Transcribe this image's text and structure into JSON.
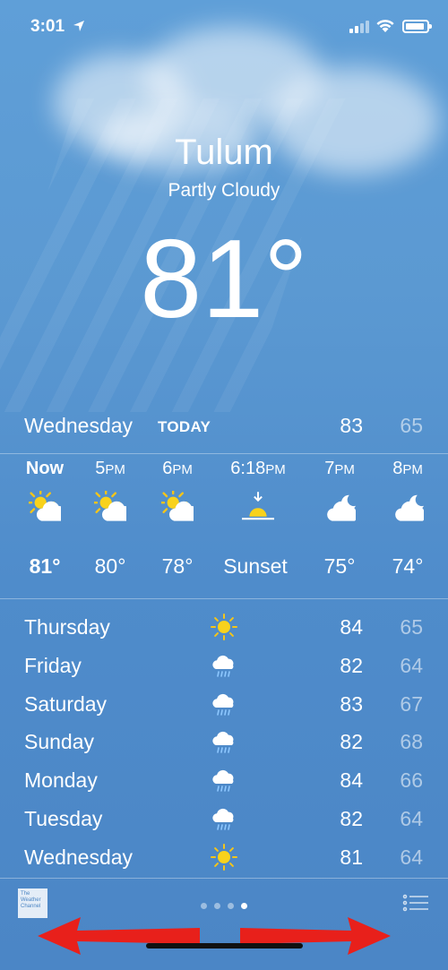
{
  "status_bar": {
    "time": "3:01",
    "location_icon": "location-arrow-icon",
    "signal_icon": "cellular-signal-icon",
    "wifi_icon": "wifi-icon",
    "battery_icon": "battery-icon"
  },
  "location": {
    "city": "Tulum",
    "condition": "Partly Cloudy",
    "temperature": "81°"
  },
  "today": {
    "day": "Wednesday",
    "tag": "TODAY",
    "high": "83",
    "low": "65"
  },
  "hourly": [
    {
      "time": "Now",
      "suffix": "",
      "icon": "partly-cloudy-day-icon",
      "temp": "81°"
    },
    {
      "time": "5",
      "suffix": "PM",
      "icon": "partly-cloudy-day-icon",
      "temp": "80°"
    },
    {
      "time": "6",
      "suffix": "PM",
      "icon": "partly-cloudy-day-icon",
      "temp": "78°"
    },
    {
      "time": "6:18",
      "suffix": "PM",
      "icon": "sunset-icon",
      "temp": "Sunset"
    },
    {
      "time": "7",
      "suffix": "PM",
      "icon": "partly-cloudy-night-icon",
      "temp": "75°"
    },
    {
      "time": "8",
      "suffix": "PM",
      "icon": "partly-cloudy-night-icon",
      "temp": "74°"
    }
  ],
  "daily": [
    {
      "day": "Thursday",
      "icon": "sun-icon",
      "high": "84",
      "low": "65"
    },
    {
      "day": "Friday",
      "icon": "rain-cloud-icon",
      "high": "82",
      "low": "64"
    },
    {
      "day": "Saturday",
      "icon": "rain-cloud-icon",
      "high": "83",
      "low": "67"
    },
    {
      "day": "Sunday",
      "icon": "rain-cloud-icon",
      "high": "82",
      "low": "68"
    },
    {
      "day": "Monday",
      "icon": "rain-cloud-icon",
      "high": "84",
      "low": "66"
    },
    {
      "day": "Tuesday",
      "icon": "rain-cloud-icon",
      "high": "82",
      "low": "64"
    },
    {
      "day": "Wednesday",
      "icon": "sun-icon",
      "high": "81",
      "low": "64"
    }
  ],
  "bottom_bar": {
    "logo_text": "The Weather Channel",
    "page_count": 4,
    "active_page": 4,
    "list_icon": "list-icon",
    "annotation_color": "#e8201b"
  }
}
